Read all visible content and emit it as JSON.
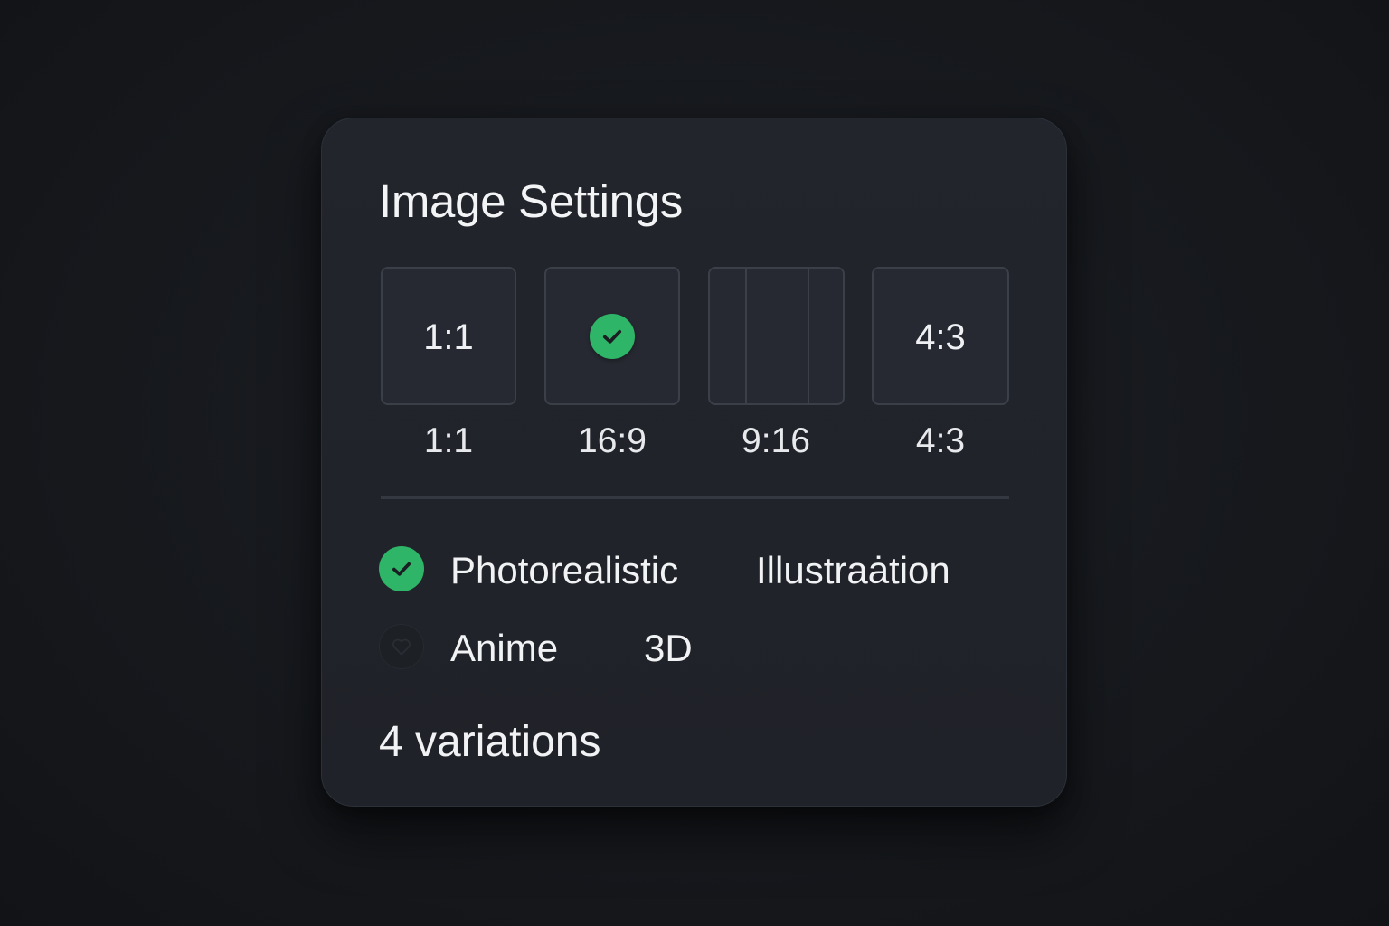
{
  "panel": {
    "title": "Image Settings"
  },
  "aspect_ratios": {
    "selected": "16:9",
    "options": [
      {
        "tile_text": "1:1",
        "label": "1:1"
      },
      {
        "tile_icon": "check-circle-icon",
        "label": "16:9"
      },
      {
        "tile_icon": "portrait-columns-icon",
        "label": "9:16"
      },
      {
        "tile_text": "4:3",
        "label": "4:3"
      }
    ]
  },
  "styles": {
    "options": [
      {
        "label": "Photorealistiс",
        "checked": true
      },
      {
        "label": "Illustraȧtion",
        "checked": false
      },
      {
        "label": "Anime",
        "checked": false
      },
      {
        "label": "3D",
        "checked": false
      }
    ]
  },
  "variations": {
    "label": "4 variations"
  },
  "colors": {
    "accent_green": "#2eb567",
    "card_background": "#22252c",
    "page_background": "#15171b",
    "text": "#f1f2f4"
  }
}
